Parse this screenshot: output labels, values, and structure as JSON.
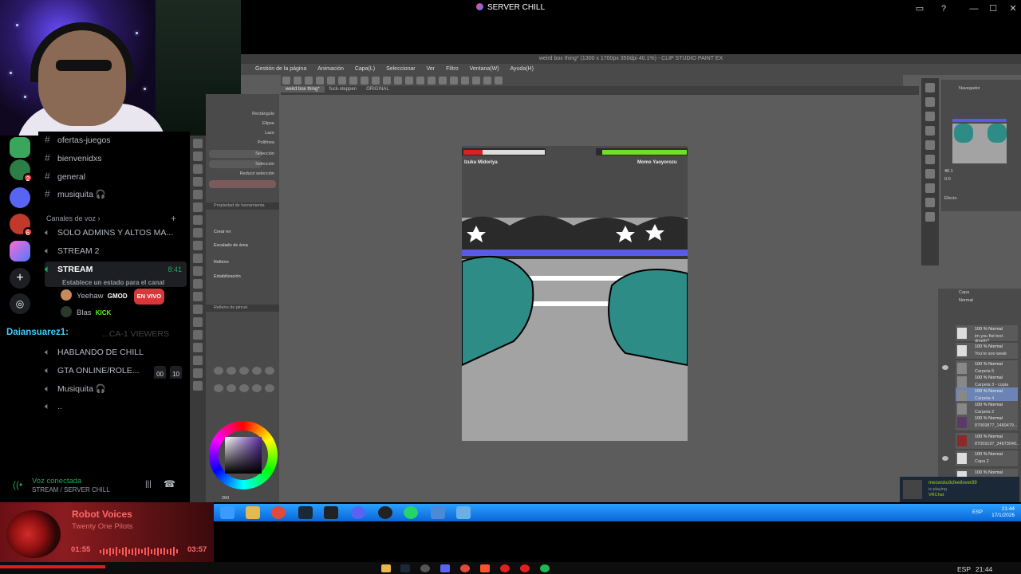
{
  "window": {
    "title": "SERVER CHILL"
  },
  "discord": {
    "channels": [
      {
        "label": "ofertas-juegos",
        "type": "text"
      },
      {
        "label": "bienvenidxs",
        "type": "text"
      },
      {
        "label": "general",
        "type": "text"
      },
      {
        "label": "musiquita 🎧",
        "type": "text"
      }
    ],
    "voice_category": "Canales de voz",
    "voice_channels": [
      {
        "label": "SOLO ADMINS Y ALTOS MA..."
      },
      {
        "label": "STREAM 2"
      },
      {
        "label": "STREAM",
        "time": "8:41",
        "status": "Establece un estado para el canal"
      },
      {
        "label": "...CA-1 VIEWERS"
      },
      {
        "label": "HABLANDO DE CHILL"
      },
      {
        "label": "GTA ONLINE/ROLE...",
        "count_a": "00",
        "count_b": "10"
      },
      {
        "label": "Musiquita 🎧"
      },
      {
        "label": ".."
      }
    ],
    "stream_users": [
      {
        "name": "Yeehaw",
        "tag": "GMOD",
        "badge": "EN VIVO"
      },
      {
        "name": "Blas",
        "tag": "KICK"
      }
    ],
    "overlay_username": "Daiansuarez1:",
    "voice_panel": {
      "status": "Voz conectada",
      "location": "STREAM / SERVER CHILL"
    },
    "server_badges": [
      "2",
      "6"
    ]
  },
  "spotify": {
    "song": "Robot Voices",
    "artist": "Twenty One Pilots",
    "time_current": "01:55",
    "time_total": "03:57",
    "progress": 0.485
  },
  "clip_studio": {
    "title": "weird box thing* (1300 x 1700px 350dpi 40.1%) - CLIP STUDIO PAINT EX",
    "menu": [
      "Gestión de la página",
      "Animación",
      "Capa(L)",
      "Seleccionar",
      "Ver",
      "Filtro",
      "Ventana(W)",
      "Ayuda(H)"
    ],
    "doc_tabs": [
      "weird box thing*",
      "fuck-steppen",
      "ORIGINAL"
    ],
    "subtool_items": [
      "Rectángulo",
      "Elipse",
      "Lazo",
      "Polilínea",
      "Selección",
      "Selección",
      "Selección",
      "Reducir selección"
    ],
    "subtool_header": "Propiedad de herramienta",
    "props": [
      "Crear en",
      "Escalado de área",
      "Relleno",
      "Estabilización"
    ],
    "color_header": "Relleno de pincel",
    "navigator_label": "Navegador",
    "navigator_values": [
      "40.1",
      "0.0"
    ],
    "effect_label": "Efecto",
    "layers_header": "Capa",
    "blend_mode": "Normal",
    "layers": [
      {
        "l1": "100 % Normal",
        "l2": "im you fist test dmeth?"
      },
      {
        "l1": "100 % Normal",
        "l2": "You're soo weak"
      },
      {
        "l1": "100 % Normal",
        "l2": "Carpeta 5"
      },
      {
        "l1": "100 % Normal",
        "l2": "Carpeta 3 - copia"
      },
      {
        "l1": "100 % Normal",
        "l2": "Carpeta 4",
        "selected": true
      },
      {
        "l1": "100 % Normal",
        "l2": "Carpeta 2"
      },
      {
        "l1": "100 % Normal",
        "l2": "87069877_1489479..."
      },
      {
        "l1": "100 % Normal",
        "l2": "87059197_34873040..."
      },
      {
        "l1": "100 % Normal",
        "l2": "Capa 2"
      },
      {
        "l1": "100 % Normal",
        "l2": ""
      }
    ],
    "canvas_left_name": "Izuku Midoriya",
    "canvas_right_name": "Momo Yaoyorozu",
    "zoom": "40.1",
    "brush_size": "260"
  },
  "win7_taskbar": {
    "lang": "ESP",
    "time": "21:44",
    "date": "17/1/2026"
  },
  "steam_notification": {
    "name": "meowskullcfeetlover89",
    "status": "is playing",
    "game": "VRChat"
  },
  "host_taskbar": {
    "lang": "ESP",
    "time": "21:44"
  },
  "colors": {
    "accent": "#23a55a",
    "live": "#da373c",
    "spotify": "#ff6a6a",
    "win7": "#0a66d8"
  }
}
